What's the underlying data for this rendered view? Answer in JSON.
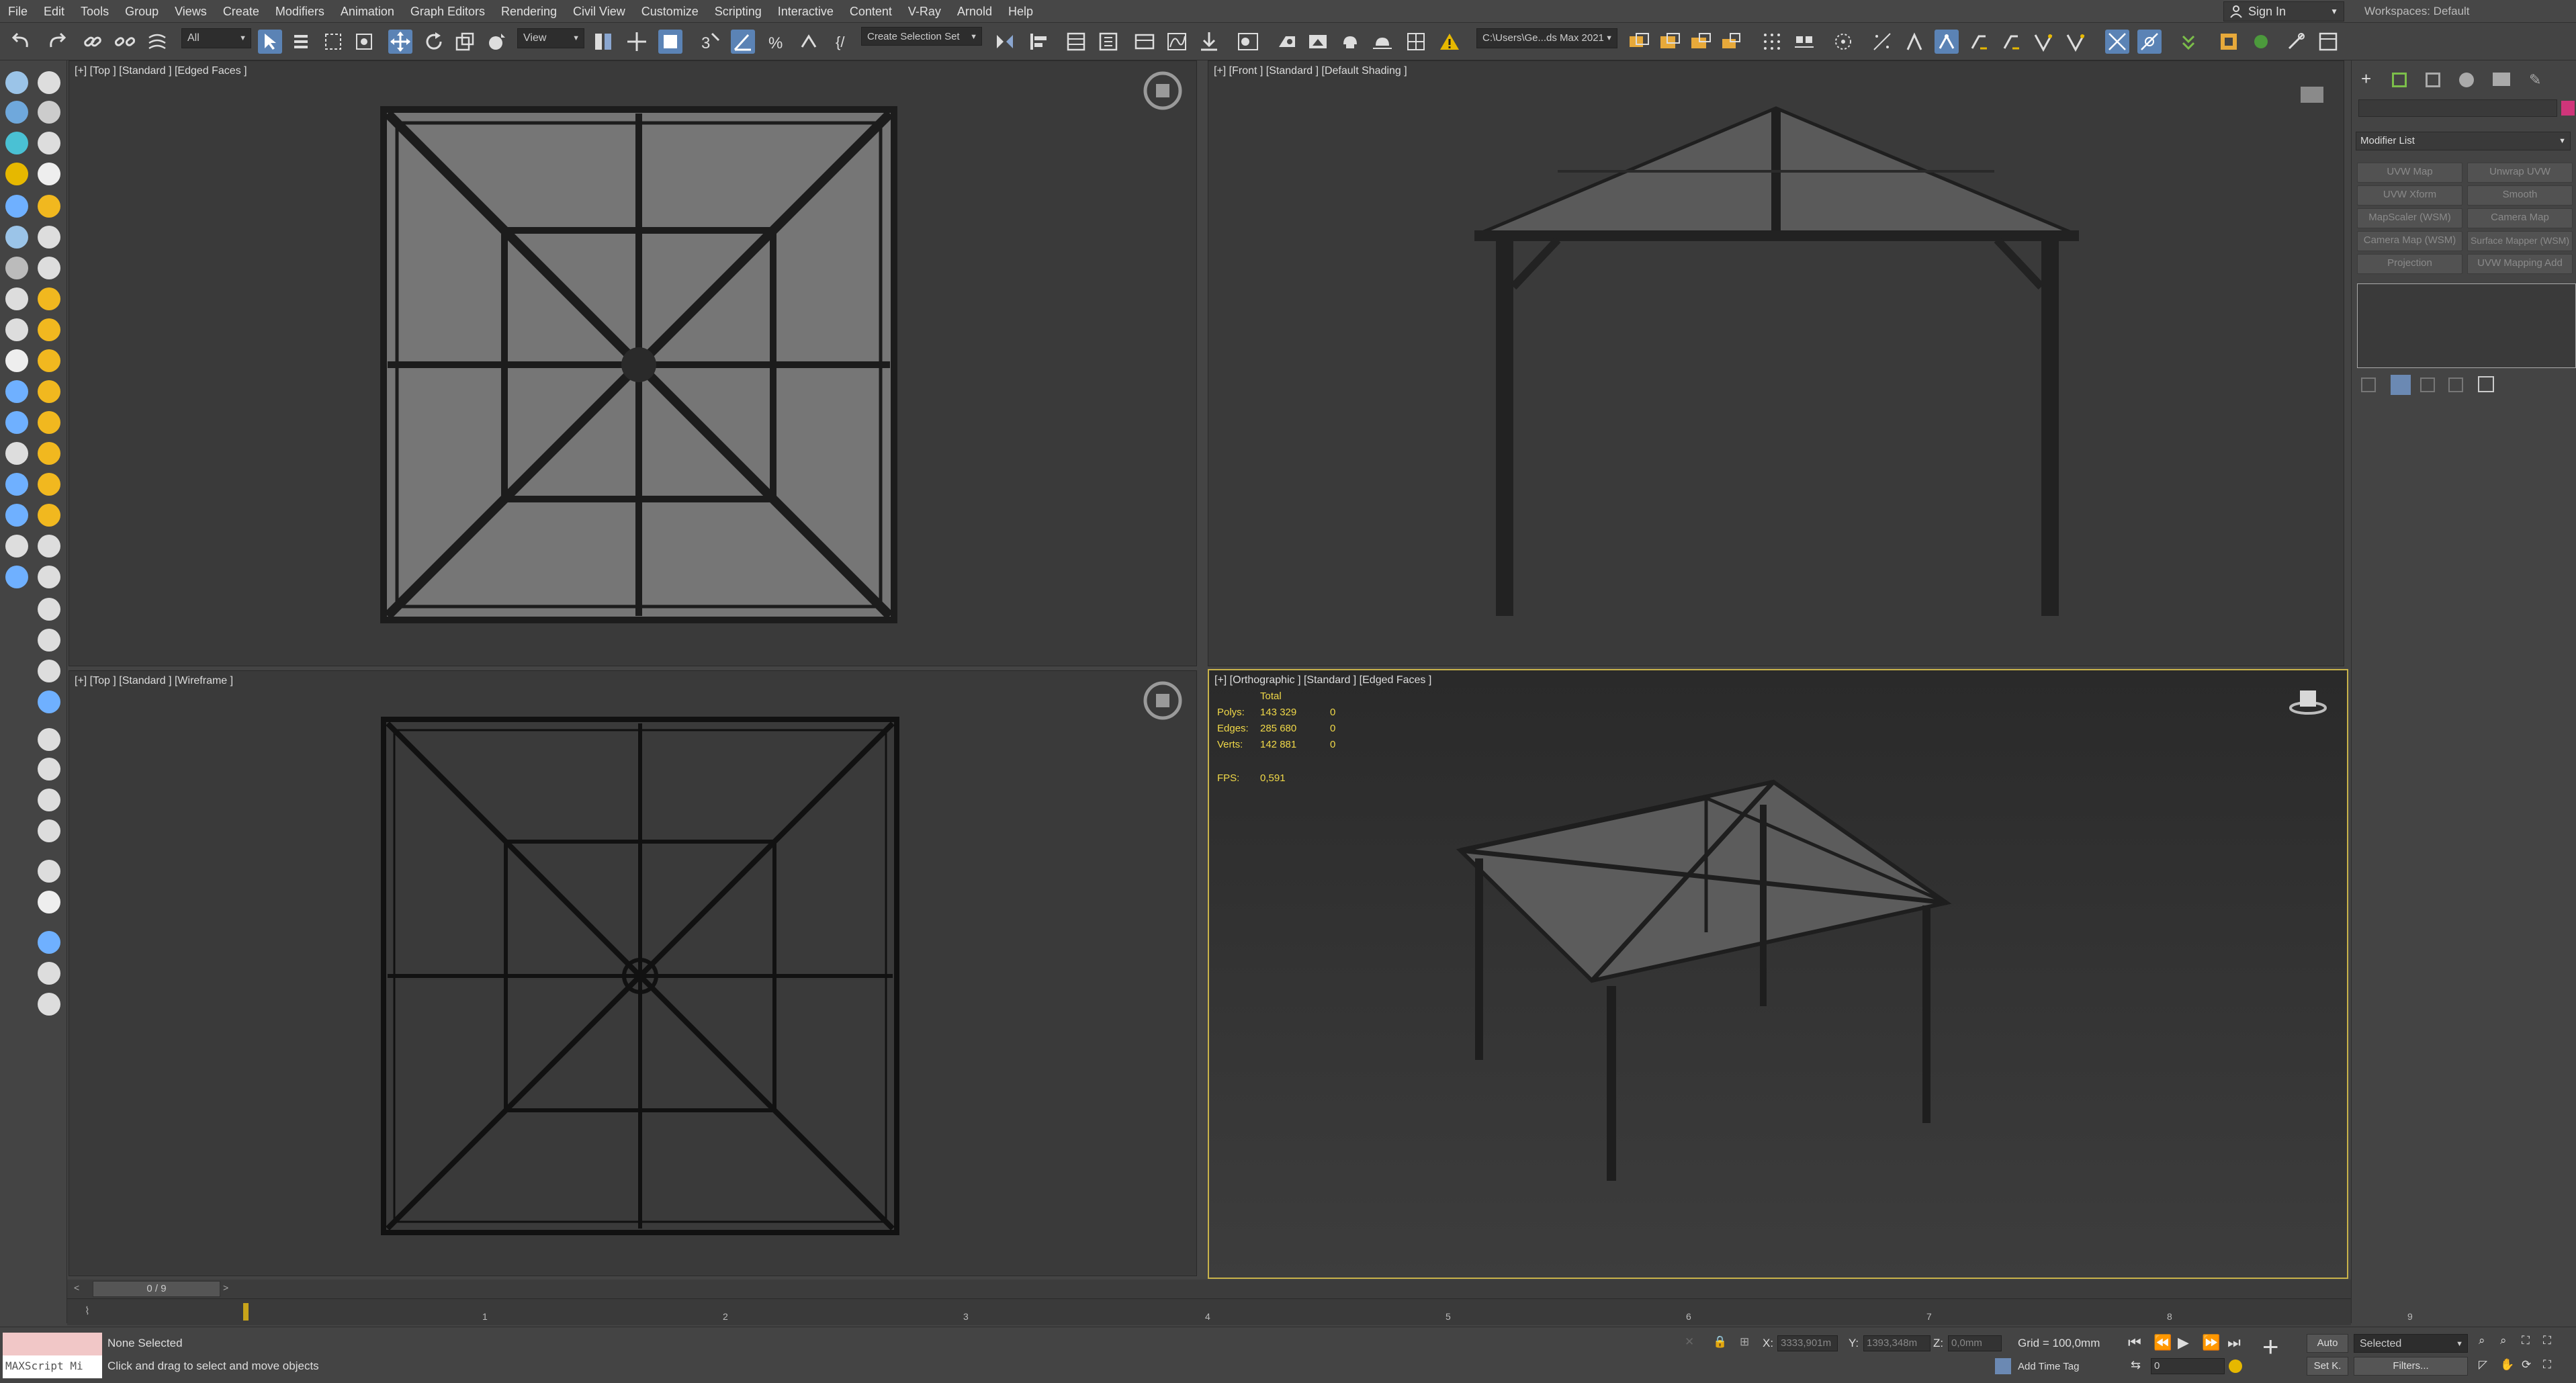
{
  "menu": [
    "File",
    "Edit",
    "Tools",
    "Group",
    "Views",
    "Create",
    "Modifiers",
    "Animation",
    "Graph Editors",
    "Rendering",
    "Civil View",
    "Customize",
    "Scripting",
    "Interactive",
    "Content",
    "V-Ray",
    "Arnold",
    "Help"
  ],
  "account": {
    "sign_in": "Sign In",
    "workspaces": "Workspaces: Default"
  },
  "toolbar": {
    "filter_value": "All",
    "refcoord_value": "View",
    "selection_set_placeholder": "Create Selection Set",
    "project_path": "C:\\Users\\Ge...ds Max 2021"
  },
  "viewports": {
    "top_left": {
      "label": "[+] [Top ] [Standard ] [Edged Faces ]"
    },
    "top_right": {
      "label": "[+] [Front ] [Standard ] [Default Shading ]"
    },
    "bottom_left": {
      "label": "[+] [Top ] [Standard ] [Wireframe ]"
    },
    "bottom_right": {
      "label": "[+] [Orthographic ] [Standard ] [Edged Faces ]",
      "stats": {
        "header": "Total",
        "polys_label": "Polys:",
        "polys": "143 329",
        "polys_sel": "0",
        "edges_label": "Edges:",
        "edges": "285 680",
        "edges_sel": "0",
        "verts_label": "Verts:",
        "verts": "142 881",
        "verts_sel": "0",
        "fps_label": "FPS:",
        "fps": "0,591"
      }
    }
  },
  "command_panel": {
    "modifier_list": "Modifier List",
    "buttons": [
      "UVW Map",
      "Unwrap UVW",
      "UVW Xform",
      "Smooth",
      "MapScaler (WSM)",
      "Camera Map",
      "Camera Map (WSM)",
      "Surface Mapper (WSM)",
      "Projection",
      "UVW Mapping Add"
    ],
    "accent_color": "#d0357a"
  },
  "timeline": {
    "frame_counter": "0 / 9",
    "ticks": [
      "1",
      "2",
      "3",
      "4",
      "5",
      "6",
      "7",
      "8",
      "9"
    ]
  },
  "status": {
    "maxscript": "MAXScript Mi",
    "selection": "None Selected",
    "prompt": "Click and drag to select and move objects",
    "x_label": "X:",
    "x_value": "3333,901m",
    "y_label": "Y:",
    "y_value": "1393,348m",
    "z_label": "Z:",
    "z_value": "0,0mm",
    "grid": "Grid = 100,0mm",
    "add_time_tag": "Add Time Tag",
    "auto": "Auto",
    "set_key": "Set K.",
    "key_mode": "Selected",
    "filters": "Filters...",
    "frame": "0"
  }
}
